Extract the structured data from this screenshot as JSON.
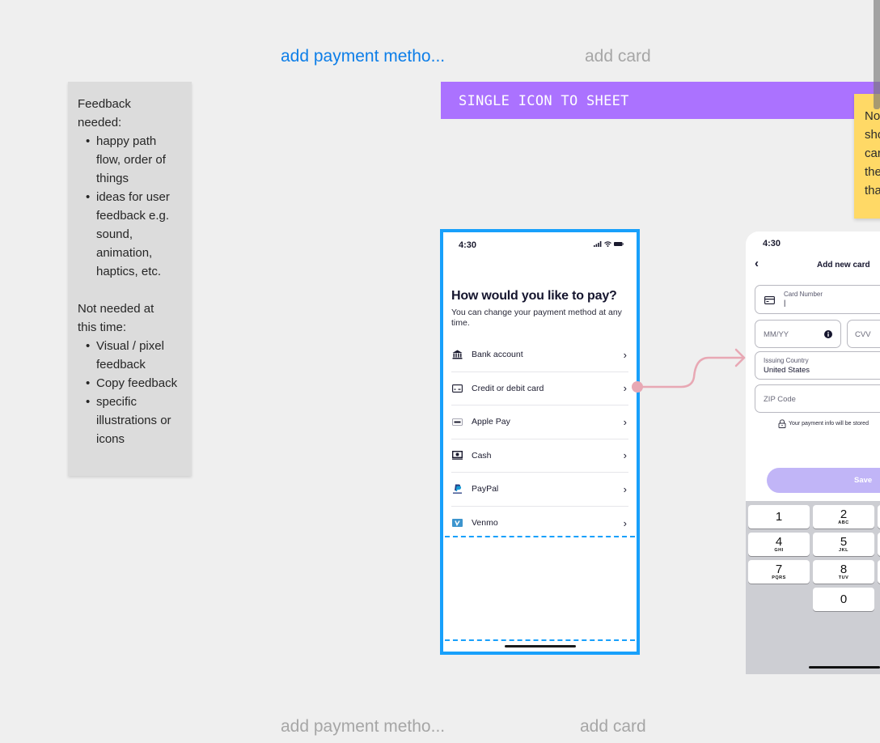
{
  "canvas": {
    "frame_labels_top": [
      {
        "text": "add payment metho...",
        "state": "selected"
      },
      {
        "text": "add card",
        "state": "default"
      }
    ],
    "frame_labels_bottom": [
      {
        "text": "add payment metho...",
        "state": "default"
      },
      {
        "text": "add card",
        "state": "default"
      }
    ],
    "section_banner": "SINGLE ICON TO SHEET",
    "colors": {
      "selection": "#18a0fb",
      "label_selected": "#0d7ee8",
      "banner": "#ab72ff",
      "sticky_grey": "#dcdcdc",
      "sticky_yellow": "#ffd966",
      "connector": "#e8a8b4",
      "save_button": "#c1b5f7"
    }
  },
  "sticky_feedback": {
    "heading1": "Feedback needed:",
    "needed": [
      "happy path flow, order of things",
      "ideas for user feedback e.g. sound, animation, haptics, etc."
    ],
    "heading2": "Not needed at this time:",
    "not_needed": [
      "Visual / pixel feedback",
      "Copy feedback",
      "specific illustrations or icons"
    ]
  },
  "sticky_yellow": {
    "lines_visible": [
      "No",
      "sho",
      "car",
      "the",
      "tha"
    ]
  },
  "phone_payment": {
    "status_time": "4:30",
    "title": "How would you like to pay?",
    "subtitle": "You can change your payment method at any time.",
    "methods": [
      {
        "label": "Bank account",
        "icon": "bank-icon"
      },
      {
        "label": "Credit or debit card",
        "icon": "card-icon"
      },
      {
        "label": "Apple Pay",
        "icon": "apple-pay-icon"
      },
      {
        "label": "Cash",
        "icon": "cash-icon"
      },
      {
        "label": "PayPal",
        "icon": "paypal-icon"
      },
      {
        "label": "Venmo",
        "icon": "venmo-icon"
      }
    ],
    "chevron": "›"
  },
  "phone_add_card": {
    "status_time": "4:30",
    "back": "‹",
    "title": "Add new card",
    "card_number_label": "Card Number",
    "card_number_value": "|",
    "expiry_placeholder": "MM/YY",
    "cvv_placeholder": "CVV",
    "country_label": "Issuing Country",
    "country_value": "United States",
    "zip_placeholder": "ZIP Code",
    "secure_note": "Your payment info will be stored",
    "save_label": "Save",
    "keys": [
      {
        "num": "1",
        "letters": ""
      },
      {
        "num": "2",
        "letters": "ABC"
      },
      {
        "num": "4",
        "letters": "GHI"
      },
      {
        "num": "5",
        "letters": "JKL"
      },
      {
        "num": "7",
        "letters": "PQRS"
      },
      {
        "num": "8",
        "letters": "TUV"
      },
      {
        "num": "0",
        "letters": ""
      }
    ]
  }
}
